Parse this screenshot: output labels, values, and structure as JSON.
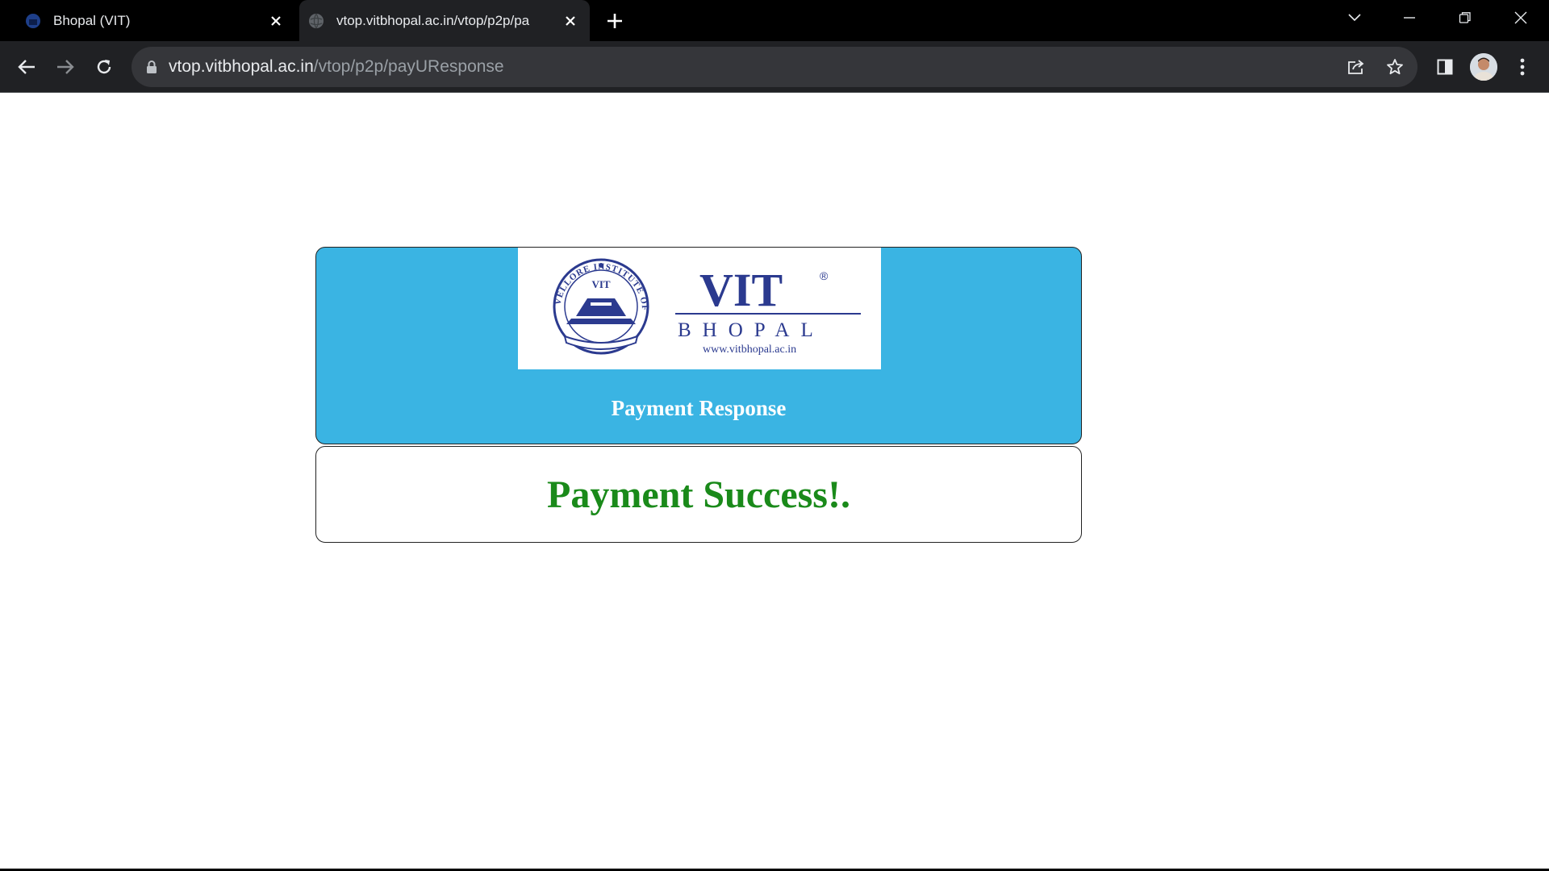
{
  "browser": {
    "tabs": [
      {
        "title": "Bhopal (VIT)",
        "favicon": "vit-favicon-icon",
        "active": false
      },
      {
        "title": "vtop.vitbhopal.ac.in/vtop/p2p/pa",
        "favicon": "globe-icon",
        "active": true
      }
    ],
    "url_host": "vtop.vitbhopal.ac.in",
    "url_path": "/vtop/p2p/payUResponse"
  },
  "page": {
    "logo": {
      "seal_text": "VELLORE INSTITUTE OF TECHNOLOGY",
      "seal_label": "VIT",
      "brand": "VIT",
      "registered": "®",
      "campus": "BHOPAL",
      "website": "www.vitbhopal.ac.in"
    },
    "header_title": "Payment Response",
    "message": "Payment Success!."
  },
  "colors": {
    "header_bg": "#3ab4e3",
    "success_text": "#1a8a1a",
    "logo_blue": "#2b3a8f"
  }
}
